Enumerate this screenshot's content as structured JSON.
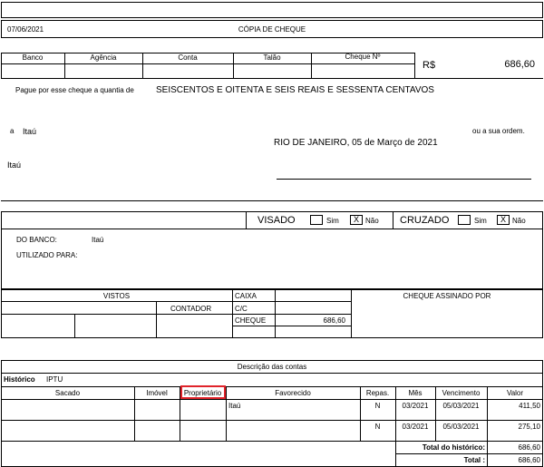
{
  "header": {
    "date": "07/06/2021",
    "title": "CÓPIA DE CHEQUE"
  },
  "check_fields": {
    "headers": [
      "Banco",
      "Agência",
      "Conta",
      "Talão",
      "Cheque Nº"
    ],
    "currency": "R$",
    "amount": "686,60"
  },
  "payment": {
    "pay_label": "Pague por esse cheque a quantia de",
    "amount_words": "SEISCENTOS E OITENTA E SEIS REAIS E SESSENTA CENTAVOS",
    "to_prefix": "a",
    "payee": "Itaú",
    "order_label": "ou a sua ordem.",
    "place_date": "RIO DE JANEIRO, 05 de Março de 2021",
    "bank_name": "Itaú"
  },
  "control": {
    "visado_label": "VISADO",
    "cruzado_label": "CRUZADO",
    "sim_label": "Sim",
    "nao_label": "Não",
    "mark": "X",
    "do_banco_label": "DO BANCO:",
    "do_banco_value": "Itaú",
    "utilizado_label": "UTILIZADO PARA:"
  },
  "vistos": {
    "vistos_label": "VISTOS",
    "contador_label": "CONTADOR",
    "caixa_label": "CAIXA",
    "cc_label": "C/C",
    "cheque_label": "CHEQUE",
    "cheque_value": "686,60",
    "assinado_label": "CHEQUE ASSINADO POR"
  },
  "contas": {
    "title": "Descrição das contas",
    "historico_label": "Histórico",
    "historico_value": "IPTU",
    "columns": [
      "Sacado",
      "Imóvel",
      "Proprietário",
      "Favorecido",
      "Repas.",
      "Mês",
      "Vencimento",
      "Valor"
    ],
    "rows": [
      {
        "sacado": "",
        "imovel": "",
        "proprietario": "",
        "favorecido": "Itaú",
        "repas": "N",
        "mes": "03/2021",
        "vencimento": "05/03/2021",
        "valor": "411,50"
      },
      {
        "sacado": "",
        "imovel": "",
        "proprietario": "",
        "favorecido": "",
        "repas": "N",
        "mes": "03/2021",
        "vencimento": "05/03/2021",
        "valor": "275,10"
      }
    ],
    "total_historico_label": "Total do histórico:",
    "total_historico_value": "686,60",
    "total_label": "Total :",
    "total_value": "686,60"
  },
  "highlight_color": "#e0232a"
}
